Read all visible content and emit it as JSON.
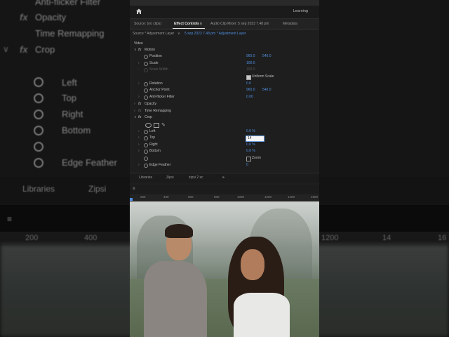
{
  "background": {
    "rows": [
      "Anti-flicker Filter",
      "Opacity",
      "Time Remapping",
      "Crop",
      "Left",
      "Top",
      "Right",
      "Bottom",
      "",
      "Edge Feather"
    ],
    "tabs": [
      "Libraries",
      "Zipsi"
    ],
    "ruler": [
      "200",
      "400",
      "1200",
      "14",
      "16"
    ]
  },
  "app": {
    "learning": "Learning",
    "tabs": {
      "source": "Source: (no clips)",
      "effect_controls": "Effect Controls",
      "menu_icon": "≡",
      "audio_mixer": "Audio Clip Mixer: 5 sep 2023 7.48 pm",
      "metadata": "Metadata"
    },
    "source_bar": {
      "source": "Source * Adjustment Layer",
      "arrow": "∨",
      "sequence": "5 sep 2023 7.48 pm * Adjustment Layer"
    },
    "section_video": "Video",
    "motion": {
      "label": "Motion",
      "position_label": "Position",
      "position_x": "960.0",
      "position_y": "540.0",
      "scale_label": "Scale",
      "scale_value": "100.0",
      "scale_width_label": "Scale Width",
      "scale_width_value": "100.0",
      "uniform_scale_label": "Uniform Scale",
      "rotation_label": "Rotation",
      "rotation_value": "0.0",
      "anchor_label": "Anchor Point",
      "anchor_x": "960.0",
      "anchor_y": "540.0",
      "antiflicker_label": "Anti-flicker Filter",
      "antiflicker_value": "0.00"
    },
    "opacity_label": "Opacity",
    "time_remap_label": "Time Remapping",
    "crop": {
      "label": "Crop",
      "pen_glyph": "✎",
      "left_label": "Left",
      "left_value": "0.0 %",
      "top_label": "Top",
      "top_value": "14",
      "right_label": "Right",
      "right_value": "0.0 %",
      "bottom_label": "Bottom",
      "bottom_value": "0.0 %",
      "zoom_label": "Zoom",
      "edge_label": "Edge Feather",
      "edge_value": "0"
    },
    "bottom_tabs": {
      "libraries": "Libraries",
      "zipsi": "Zipsi",
      "zipsi2": "zipsi 2 sc",
      "more": "»"
    },
    "program_menu": "≡",
    "ruler": [
      "200",
      "400",
      "600",
      "800",
      "1000",
      "1200",
      "1400",
      "1600"
    ],
    "glyphs": {
      "chev_down": "∨",
      "chev_right": "›"
    }
  },
  "colors": {
    "accent": "#4f8fe0",
    "panel": "#1e1e1e"
  }
}
